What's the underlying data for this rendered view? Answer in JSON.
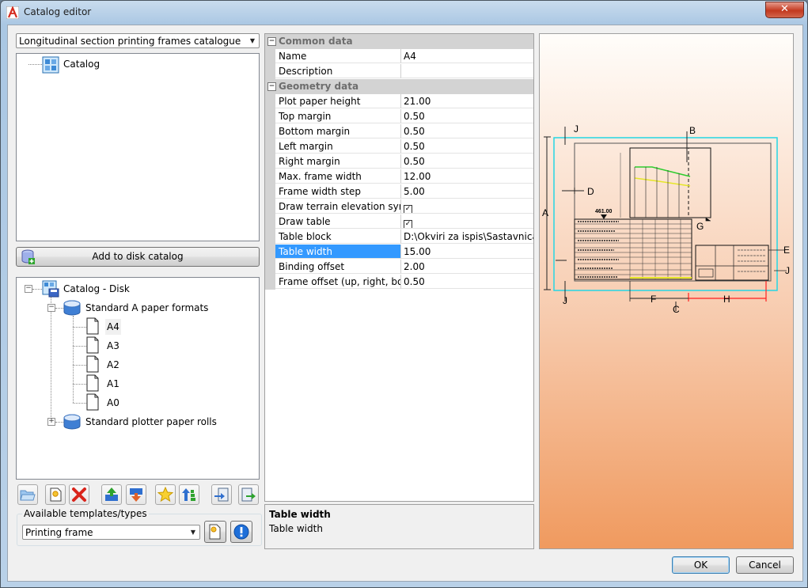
{
  "window": {
    "title": "Catalog editor",
    "close_glyph": "✕"
  },
  "catalog_select": {
    "value": "Longitudinal section printing frames catalogue"
  },
  "catalog_tree": {
    "root_label": "Catalog"
  },
  "add_button": {
    "label": "Add to disk catalog"
  },
  "disk_tree": {
    "root_label": "Catalog - Disk",
    "groups": [
      {
        "label": "Standard A paper formats",
        "items": [
          "A4",
          "A3",
          "A2",
          "A1",
          "A0"
        ]
      },
      {
        "label": "Standard plotter paper rolls"
      }
    ]
  },
  "toolbar_icons": [
    "open-folder-icon",
    "new-item-icon",
    "delete-icon",
    "move-up-icon",
    "move-down-icon",
    "favorite-star-icon",
    "sort-icon",
    "import-icon",
    "export-icon"
  ],
  "templates": {
    "caption": "Available templates/types",
    "value": "Printing frame"
  },
  "grid": {
    "categories": [
      {
        "label": "Common data",
        "rows": [
          {
            "name": "Name",
            "value": "A4"
          },
          {
            "name": "Description",
            "value": ""
          }
        ]
      },
      {
        "label": "Geometry data",
        "rows": [
          {
            "name": "Plot paper height",
            "value": "21.00"
          },
          {
            "name": "Top margin",
            "value": "0.50"
          },
          {
            "name": "Bottom margin",
            "value": "0.50"
          },
          {
            "name": "Left margin",
            "value": "0.50"
          },
          {
            "name": "Right margin",
            "value": "0.50"
          },
          {
            "name": "Max. frame width",
            "value": "12.00"
          },
          {
            "name": "Frame width step",
            "value": "5.00"
          },
          {
            "name": "Draw terrain elevation symbo",
            "value": "",
            "checkbox": true
          },
          {
            "name": "Draw table",
            "value": "",
            "checkbox": true
          },
          {
            "name": "Table block",
            "value": "D:\\Okviri za ispis\\Sastavnica.dw"
          },
          {
            "name": "Table width",
            "value": "15.00",
            "selected": true
          },
          {
            "name": "Binding offset",
            "value": "2.00"
          },
          {
            "name": "Frame offset (up, right, botto",
            "value": "0.50"
          }
        ]
      }
    ]
  },
  "description": {
    "title": "Table width",
    "text": "Table width"
  },
  "preview": {
    "labels": {
      "a": "A",
      "b": "B",
      "c": "C",
      "d": "D",
      "e": "E",
      "f": "F",
      "g": "G",
      "h": "H",
      "j": "J"
    },
    "elevation": "461.00"
  },
  "ok_button": {
    "label": "OK"
  },
  "cancel_button": {
    "label": "Cancel"
  },
  "colors": {
    "accent": "#3399ff",
    "close_red": "#c7402a",
    "preview_cyan": "#25d6e4",
    "preview_red": "#ff2020"
  }
}
